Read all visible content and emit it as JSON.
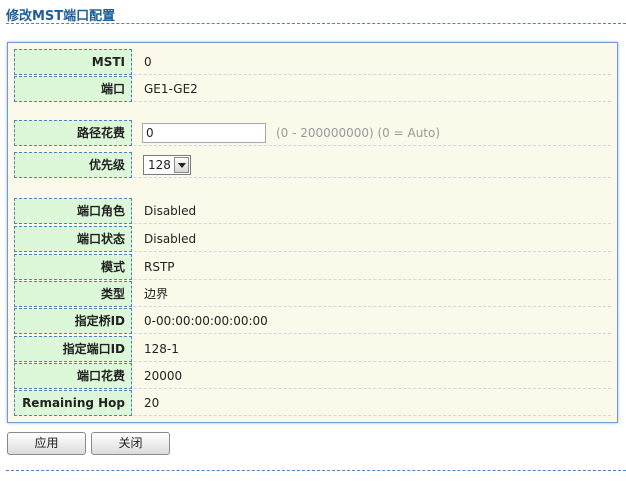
{
  "page": {
    "title": "修改MST端口配置"
  },
  "rows": {
    "msti": {
      "label": "MSTI",
      "value": "0"
    },
    "port": {
      "label": "端口",
      "value": "GE1-GE2"
    },
    "path_cost": {
      "label": "路径花费",
      "value": "0",
      "hint": "(0 - 200000000) (0 = Auto)"
    },
    "priority": {
      "label": "优先级",
      "value": "128"
    },
    "port_role": {
      "label": "端口角色",
      "value": "Disabled"
    },
    "port_state": {
      "label": "端口状态",
      "value": "Disabled"
    },
    "mode": {
      "label": "模式",
      "value": "RSTP"
    },
    "type": {
      "label": "类型",
      "value": "边界"
    },
    "designated_bridge": {
      "label": "指定桥ID",
      "value": "0-00:00:00:00:00:00"
    },
    "designated_port": {
      "label": "指定端口ID",
      "value": "128-1"
    },
    "port_cost": {
      "label": "端口花费",
      "value": "20000"
    },
    "remaining_hop": {
      "label": "Remaining Hop",
      "value": "20"
    }
  },
  "buttons": {
    "apply": "应用",
    "close": "关闭"
  }
}
